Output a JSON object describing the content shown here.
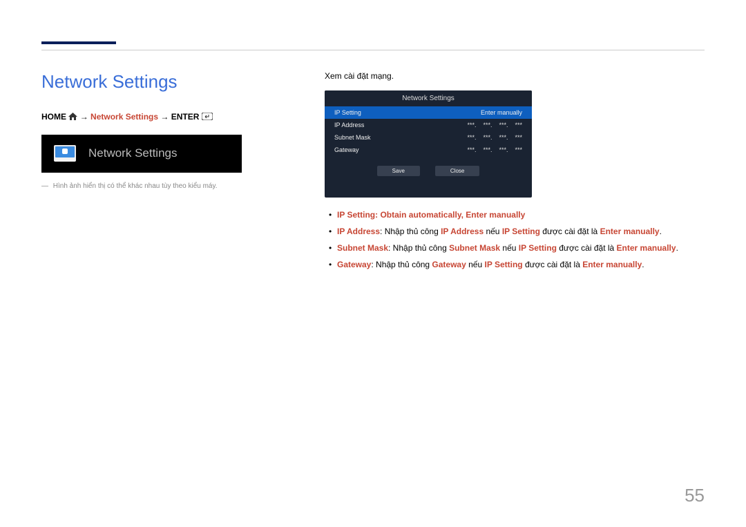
{
  "section": {
    "title": "Network Settings"
  },
  "breadcrumb": {
    "home": "HOME",
    "arrow1": " → ",
    "netset": "Network Settings",
    "arrow2": "→ ",
    "enter": "ENTER"
  },
  "thumb": {
    "label": "Network Settings"
  },
  "note": "Hình ảnh hiển thị có thể khác nhau tùy theo kiểu máy.",
  "right": {
    "lead": "Xem cài đặt mạng."
  },
  "panel": {
    "title": "Network Settings",
    "header": {
      "left": "IP Setting",
      "right": "Enter manually"
    },
    "rows": [
      {
        "label": "IP Address",
        "v": [
          "***.",
          "***.",
          "***.",
          "***"
        ]
      },
      {
        "label": "Subnet Mask",
        "v": [
          "***.",
          "***.",
          "***.",
          "***"
        ]
      },
      {
        "label": "Gateway",
        "v": [
          "***.",
          "***.",
          "***.",
          "***"
        ]
      }
    ],
    "buttons": {
      "save": "Save",
      "close": "Close"
    }
  },
  "bullets": {
    "b1": {
      "ip_setting": "IP Setting",
      "colon": ": ",
      "obtain": "Obtain automatically",
      "comma": ", ",
      "enter_manually": "Enter manually"
    },
    "b2": {
      "ip_address": "IP Address",
      "colon": ": Nhập thủ công ",
      "ip_address2": "IP Address",
      "neu": " nếu ",
      "ip_setting": "IP Setting",
      "rest": " được cài đặt là ",
      "enter_manually": "Enter manually",
      "period": "."
    },
    "b3": {
      "subnet": "Subnet Mask",
      "colon": ": Nhập thủ công ",
      "subnet2": "Subnet Mask",
      "neu": " nếu ",
      "ip_setting": "IP Setting",
      "rest": " được cài đặt là ",
      "enter_manually": "Enter manually",
      "period": "."
    },
    "b4": {
      "gateway": "Gateway",
      "colon": ": Nhập thủ công ",
      "gateway2": "Gateway",
      "neu": " nếu ",
      "ip_setting": "IP Setting",
      "rest": " được cài đặt là ",
      "enter_manually": "Enter manually",
      "period": "."
    }
  },
  "page_number": "55"
}
